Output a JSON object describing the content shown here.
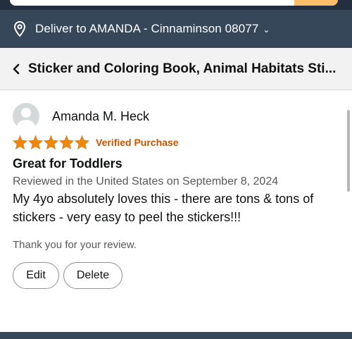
{
  "deliver": {
    "text": "Deliver to AMANDA - Cinnaminson 08077",
    "chevron": "⌄",
    "icon": "location-pin-icon"
  },
  "product": {
    "back_icon": "chevron-left-icon",
    "title": "Sticker and Coloring Book, Animal Habitats Sti..."
  },
  "review": {
    "reviewer_name": "Amanda M. Heck",
    "rating": 5,
    "rating_max": 5,
    "verified_label": "Verified Purchase",
    "title": "Great for Toddlers",
    "meta": "Reviewed in the United States on September 8, 2024",
    "body": "My 4yo absolutely loves this - there are tons & tons of stickers - very easy to peel the stickers!!!",
    "thanks": "Thank you for your review.",
    "edit_label": "Edit",
    "delete_label": "Delete"
  },
  "colors": {
    "header_dark": "#232f3e",
    "deliver_bar": "#37475a",
    "star": "#f08804",
    "verified": "#c45500"
  }
}
